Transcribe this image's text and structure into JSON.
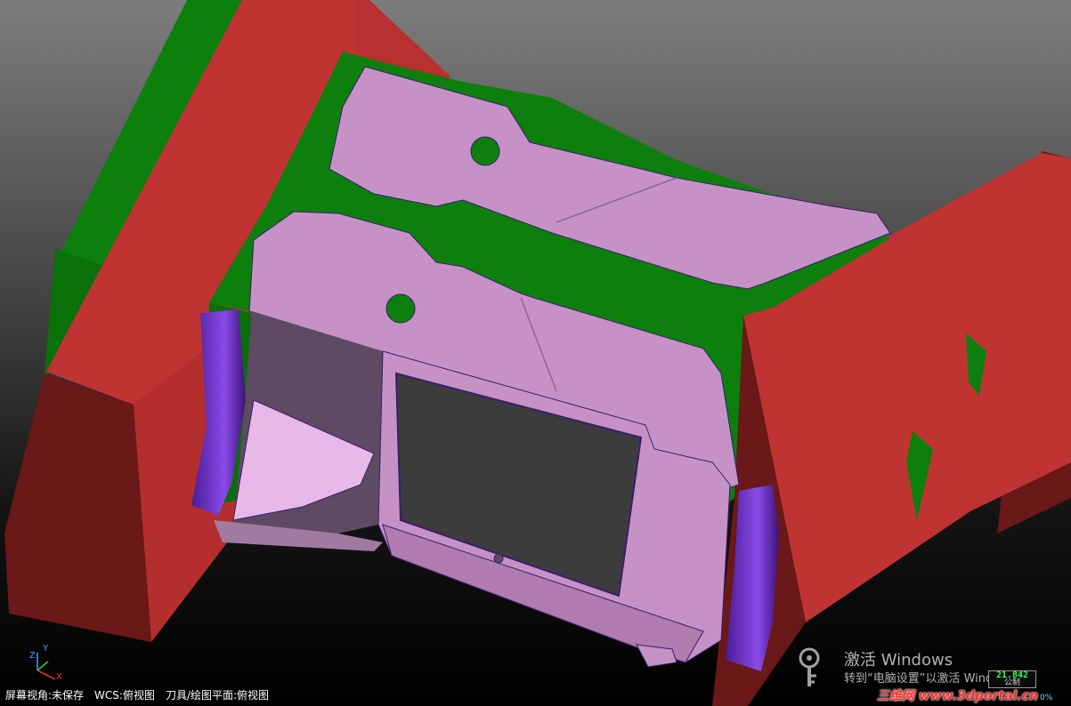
{
  "viewport": {
    "part": "part-body",
    "colors": {
      "background_top": "#7d7d7d",
      "background_bottom": "#000000",
      "block_red": "#b83030",
      "block_red_dark": "#6a1818",
      "parting_green": "#0c7f0c",
      "part_pink": "#c692c6",
      "part_shadow": "#5e4a62",
      "purple_face": "#7a3bd0"
    }
  },
  "axis": {
    "y": "Y",
    "z": "Z",
    "x": "X"
  },
  "status_bar": {
    "view": "屏幕视角:未保存",
    "wcs": "WCS:俯视图",
    "tool_plane": "刀具/绘图平面:俯视图"
  },
  "activation": {
    "title": "激活 Windows",
    "subtitle": "转到“电脑设置”以激活 Windows。"
  },
  "scale": {
    "value": "21.842",
    "unit": "公制"
  },
  "watermark": "三维网 www.3dportal.cn",
  "corner_percent": "0%"
}
